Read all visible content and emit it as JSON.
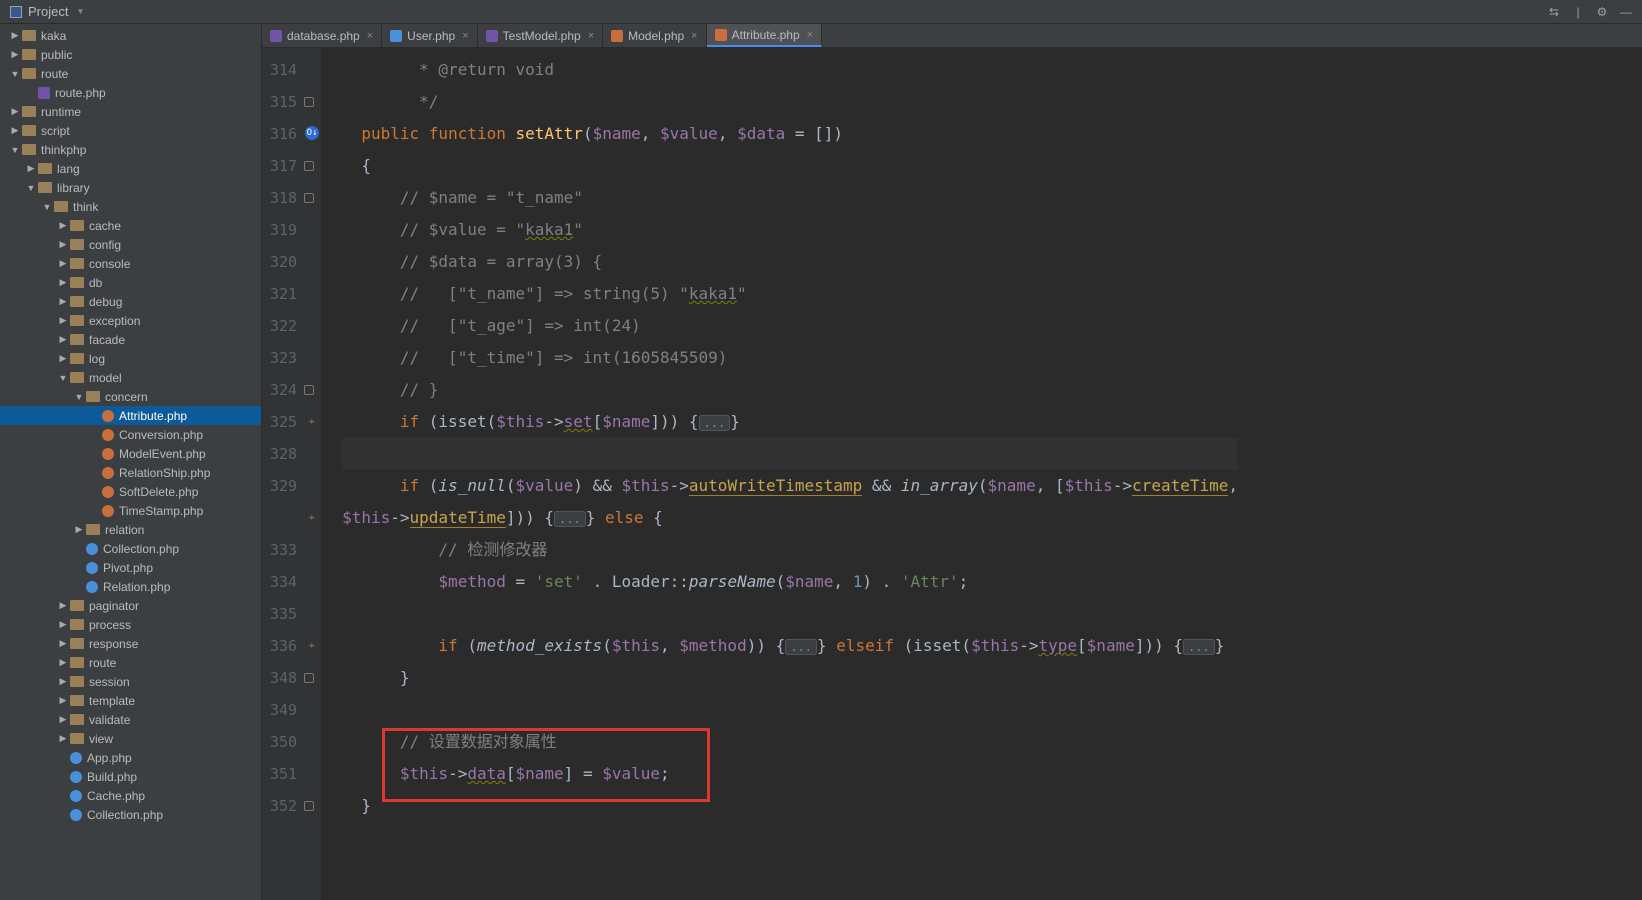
{
  "topbar": {
    "project_label": "Project"
  },
  "sidebar": {
    "items": [
      {
        "depth": 0,
        "arrow": "closed",
        "icon": "folder",
        "label": "kaka"
      },
      {
        "depth": 0,
        "arrow": "closed",
        "icon": "folder",
        "label": "public"
      },
      {
        "depth": 0,
        "arrow": "open",
        "icon": "folder",
        "label": "route"
      },
      {
        "depth": 1,
        "arrow": "none",
        "icon": "php",
        "label": "route.php"
      },
      {
        "depth": 0,
        "arrow": "closed",
        "icon": "folder",
        "label": "runtime"
      },
      {
        "depth": 0,
        "arrow": "closed",
        "icon": "folder",
        "label": "script"
      },
      {
        "depth": 0,
        "arrow": "open",
        "icon": "folder",
        "label": "thinkphp"
      },
      {
        "depth": 1,
        "arrow": "closed",
        "icon": "folder",
        "label": "lang"
      },
      {
        "depth": 1,
        "arrow": "open",
        "icon": "folder",
        "label": "library"
      },
      {
        "depth": 2,
        "arrow": "open",
        "icon": "folder",
        "label": "think"
      },
      {
        "depth": 3,
        "arrow": "closed",
        "icon": "folder",
        "label": "cache"
      },
      {
        "depth": 3,
        "arrow": "closed",
        "icon": "folder",
        "label": "config"
      },
      {
        "depth": 3,
        "arrow": "closed",
        "icon": "folder",
        "label": "console"
      },
      {
        "depth": 3,
        "arrow": "closed",
        "icon": "folder",
        "label": "db"
      },
      {
        "depth": 3,
        "arrow": "closed",
        "icon": "folder",
        "label": "debug"
      },
      {
        "depth": 3,
        "arrow": "closed",
        "icon": "folder",
        "label": "exception"
      },
      {
        "depth": 3,
        "arrow": "closed",
        "icon": "folder",
        "label": "facade"
      },
      {
        "depth": 3,
        "arrow": "closed",
        "icon": "folder",
        "label": "log"
      },
      {
        "depth": 3,
        "arrow": "open",
        "icon": "folder",
        "label": "model"
      },
      {
        "depth": 4,
        "arrow": "open",
        "icon": "folder",
        "label": "concern"
      },
      {
        "depth": 5,
        "arrow": "none",
        "icon": "m",
        "label": "Attribute.php",
        "selected": true
      },
      {
        "depth": 5,
        "arrow": "none",
        "icon": "m",
        "label": "Conversion.php"
      },
      {
        "depth": 5,
        "arrow": "none",
        "icon": "m",
        "label": "ModelEvent.php"
      },
      {
        "depth": 5,
        "arrow": "none",
        "icon": "m",
        "label": "RelationShip.php"
      },
      {
        "depth": 5,
        "arrow": "none",
        "icon": "m",
        "label": "SoftDelete.php"
      },
      {
        "depth": 5,
        "arrow": "none",
        "icon": "m",
        "label": "TimeStamp.php"
      },
      {
        "depth": 4,
        "arrow": "closed",
        "icon": "folder",
        "label": "relation"
      },
      {
        "depth": 4,
        "arrow": "none",
        "icon": "c",
        "label": "Collection.php"
      },
      {
        "depth": 4,
        "arrow": "none",
        "icon": "c",
        "label": "Pivot.php"
      },
      {
        "depth": 4,
        "arrow": "none",
        "icon": "c",
        "label": "Relation.php"
      },
      {
        "depth": 3,
        "arrow": "closed",
        "icon": "folder",
        "label": "paginator"
      },
      {
        "depth": 3,
        "arrow": "closed",
        "icon": "folder",
        "label": "process"
      },
      {
        "depth": 3,
        "arrow": "closed",
        "icon": "folder",
        "label": "response"
      },
      {
        "depth": 3,
        "arrow": "closed",
        "icon": "folder",
        "label": "route"
      },
      {
        "depth": 3,
        "arrow": "closed",
        "icon": "folder",
        "label": "session"
      },
      {
        "depth": 3,
        "arrow": "closed",
        "icon": "folder",
        "label": "template"
      },
      {
        "depth": 3,
        "arrow": "closed",
        "icon": "folder",
        "label": "validate"
      },
      {
        "depth": 3,
        "arrow": "closed",
        "icon": "folder",
        "label": "view"
      },
      {
        "depth": 3,
        "arrow": "none",
        "icon": "c",
        "label": "App.php"
      },
      {
        "depth": 3,
        "arrow": "none",
        "icon": "c",
        "label": "Build.php"
      },
      {
        "depth": 3,
        "arrow": "none",
        "icon": "c",
        "label": "Cache.php"
      },
      {
        "depth": 3,
        "arrow": "none",
        "icon": "c",
        "label": "Collection.php"
      }
    ]
  },
  "tabs": [
    {
      "icon": "php",
      "label": "database.php",
      "active": false
    },
    {
      "icon": "c",
      "label": "User.php",
      "active": false
    },
    {
      "icon": "php",
      "label": "TestModel.php",
      "active": false
    },
    {
      "icon": "m",
      "label": "Model.php",
      "active": false
    },
    {
      "icon": "m",
      "label": "Attribute.php",
      "active": true
    }
  ],
  "gutter_lines": [
    "314",
    "315",
    "316",
    "317",
    "318",
    "319",
    "320",
    "321",
    "322",
    "323",
    "324",
    "325",
    "328",
    "329",
    "",
    "333",
    "334",
    "335",
    "336",
    "348",
    "349",
    "350",
    "351",
    "352"
  ],
  "code": {
    "l314": " * @return void",
    "l315": " */",
    "l316_public": "public",
    "l316_function": "function",
    "l316_setAttr": "setAttr",
    "l316_name": "$name",
    "l316_value": "$value",
    "l316_data": "$data",
    "l317": "{",
    "l318": "// $name = \"t_name\"",
    "l319a": "// $value = \"",
    "l319b": "kaka1",
    "l319c": "\"",
    "l320": "// $data = array(3) {",
    "l321a": "//   [\"t_name\"] => string(5) \"",
    "l321b": "kaka1",
    "l321c": "\"",
    "l322": "//   [\"t_age\"] => int(24)",
    "l323": "//   [\"t_time\"] => int(1605845509)",
    "l324": "// }",
    "l325_if": "if",
    "l325_isset": "isset",
    "l325_this": "$this",
    "l325_set": "set",
    "l325_name": "$name",
    "l329_if": "if",
    "l329_isnull": "is_null",
    "l329_value": "$value",
    "l329_this": "$this",
    "l329_awt": "autoWriteTimestamp",
    "l329_ina": "in_array",
    "l329_name": "$name",
    "l329_ct": "createTime",
    "l329b_this": "$this",
    "l329b_ut": "updateTime",
    "l329b_else": "else",
    "l333": "// 检测修改器",
    "l334_method": "$method",
    "l334_set": "'set'",
    "l334_loader": "Loader",
    "l334_pn": "parseName",
    "l334_name": "$name",
    "l334_one": "1",
    "l334_attr": "'Attr'",
    "l336_if": "if",
    "l336_me": "method_exists",
    "l336_this": "$this",
    "l336_method": "$method",
    "l336_elseif": "elseif",
    "l336_isset": "isset",
    "l336_this2": "$this",
    "l336_type": "type",
    "l336_name": "$name",
    "l348": "}",
    "l350": "// 设置数据对象属性",
    "l351_this": "$this",
    "l351_data": "data",
    "l351_name": "$name",
    "l351_value": "$value",
    "l352": "}",
    "fold": "..."
  }
}
